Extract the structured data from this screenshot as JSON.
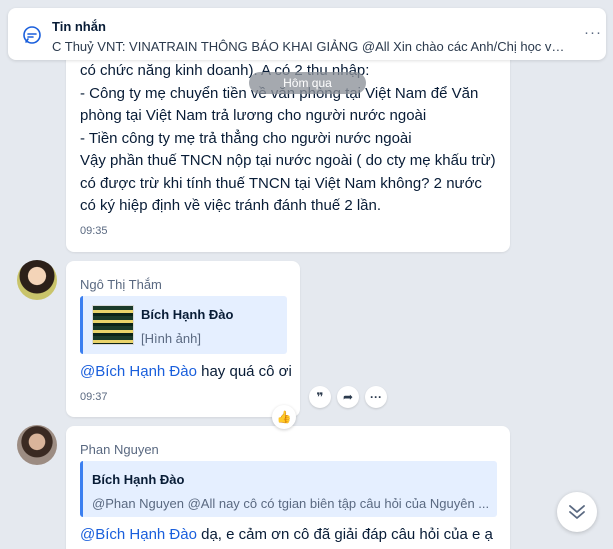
{
  "topbar": {
    "title": "Tin nhắn",
    "preview": "C Thuỷ VNT: VINATRAIN THÔNG BÁO KHAI GIẢNG @All  Xin chào các Anh/Chị học viên",
    "more": "···"
  },
  "date_divider": "Hôm qua",
  "message1": {
    "lines": [
      "có chức năng kinh doanh). A có 2 thu nhập:",
      "- Công ty mẹ chuyển tiền về văn phòng tại Việt Nam để Văn",
      "phòng tại Việt Nam trả lương cho người nước ngoài",
      "- Tiền công ty mẹ trả thẳng cho người nước ngoài",
      "Vậy phần thuế TNCN nộp tại nước ngoài ( do cty mẹ khấu trừ)",
      "có được trừ khi tính thuế TNCN tại Việt Nam không? 2 nước",
      "có ký hiệp định về việc tránh đánh thuế 2 lần."
    ],
    "time": "09:35"
  },
  "message2": {
    "sender": "Ngô Thị Thắm",
    "quote": {
      "name": "Bích Hạnh Đào",
      "sub": "[Hình ảnh]"
    },
    "mention": "@Bích Hạnh Đào",
    "text": " hay quá cô ơi",
    "time": "09:37"
  },
  "message3": {
    "sender": "Phan Nguyen",
    "quote": {
      "name": "Bích Hạnh Đào",
      "sub": "@Phan Nguyen @All nay cô có tgian biên tập câu hỏi của Nguyên ..."
    },
    "mention": "@Bích Hạnh Đào",
    "text": " dạ, e cảm ơn cô đã giải đáp câu hỏi của e ạ"
  },
  "actions": {
    "quote": "❞",
    "share": "➦",
    "more": "···",
    "like": "👍"
  }
}
